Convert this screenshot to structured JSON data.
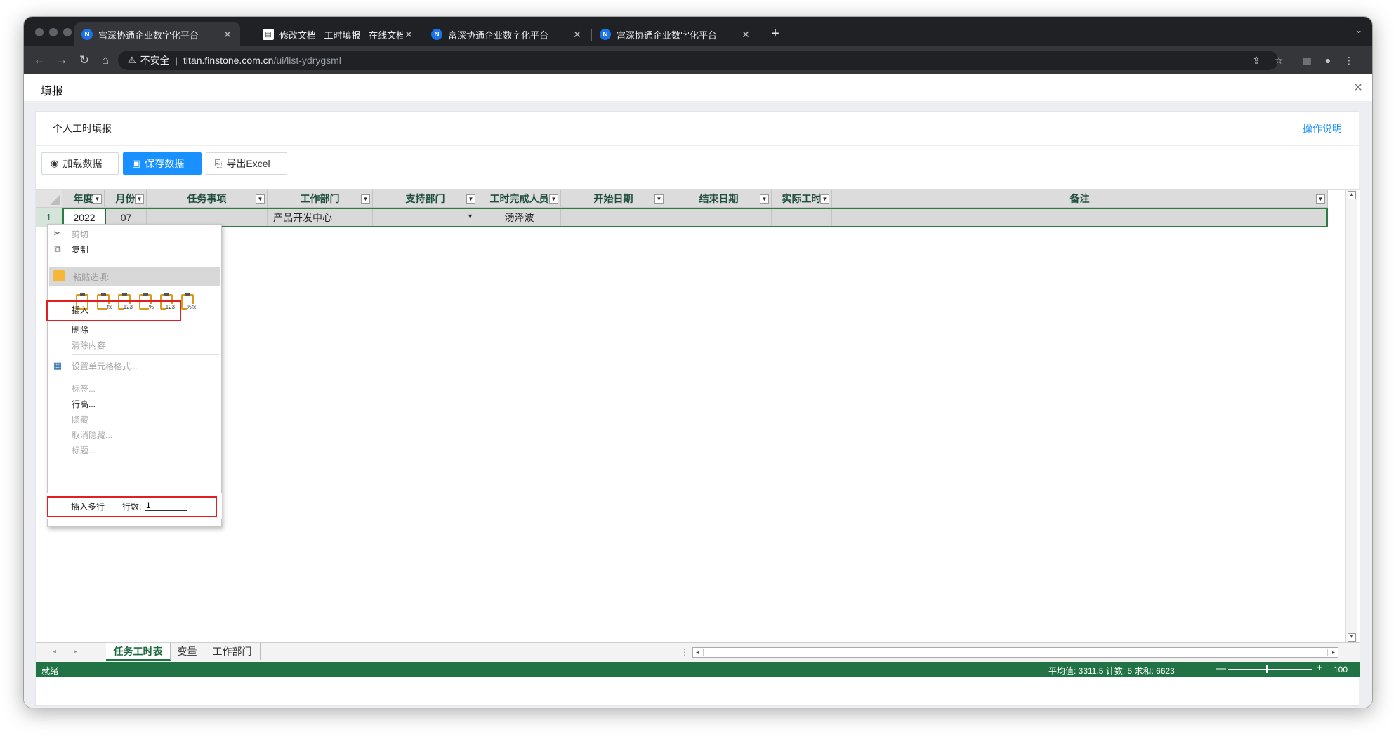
{
  "browser": {
    "tabs": [
      {
        "title": "富深协通企业数字化平台",
        "favicon": "N",
        "active": true
      },
      {
        "title": "修改文档 - 工时填报 - 在线文档",
        "favicon": "doc",
        "active": false
      },
      {
        "title": "富深协通企业数字化平台",
        "favicon": "N",
        "active": false
      },
      {
        "title": "富深协通企业数字化平台",
        "favicon": "N",
        "active": false
      }
    ],
    "new_tab": "+",
    "address": {
      "security": "不安全",
      "host": "titan.finstone.com.cn",
      "path": "/ui/list-ydrygsml"
    }
  },
  "dialog": {
    "title": "填报",
    "close": "×"
  },
  "card": {
    "title": "个人工时填报",
    "help_link": "操作说明"
  },
  "buttons": {
    "load": "加载数据",
    "save": "保存数据",
    "export": "导出Excel"
  },
  "sheet": {
    "columns": [
      "年度",
      "月份",
      "任务事项",
      "工作部门",
      "支持部门",
      "工时完成人员",
      "开始日期",
      "结束日期",
      "实际工时",
      "备注"
    ],
    "row": {
      "number": "1",
      "cells": [
        "2022",
        "07",
        "",
        "产品开发中心",
        "",
        "汤泽波",
        "",
        "",
        "",
        ""
      ]
    },
    "tabs": [
      "任务工时表",
      "变量",
      "工作部门"
    ],
    "active_tab": "任务工时表"
  },
  "status": {
    "ready": "就绪",
    "stats": "平均值: 3311.5   计数: 5   求和: 6623",
    "zoom": "100"
  },
  "context_menu": {
    "cut": "剪切",
    "copy": "复制",
    "paste_options": "粘贴选项:",
    "paste_icon_labels": [
      "",
      "fx",
      "123",
      "%",
      "123",
      "%fx"
    ],
    "insert": "插入",
    "delete": "删除",
    "clear": "清除内容",
    "format": "设置单元格格式...",
    "label": "标签...",
    "row_height": "行高...",
    "hide": "隐藏",
    "unhide": "取消隐藏...",
    "header": "标题...",
    "insert_multi": "插入多行",
    "rows_label": "行数:",
    "rows_value": "1"
  },
  "colors": {
    "excel_green": "#217346",
    "primary_blue": "#1890ff",
    "highlight_red": "#e02020"
  }
}
